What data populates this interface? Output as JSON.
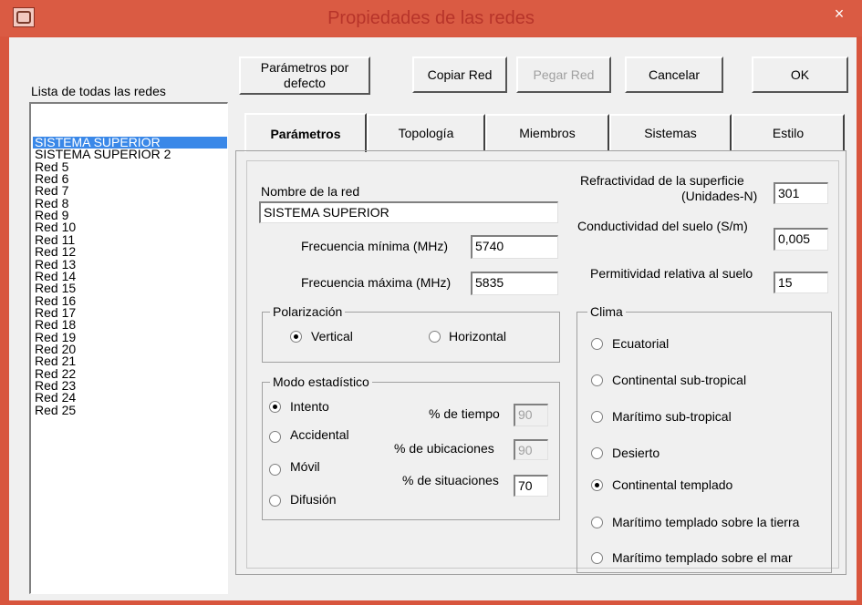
{
  "window": {
    "title": "Propiedades de las redes",
    "close_glyph": "×"
  },
  "toolbar": {
    "default_params": "Parámetros por defecto",
    "copy": "Copiar Red",
    "paste": "Pegar Red",
    "cancel": "Cancelar",
    "ok": "OK"
  },
  "list": {
    "label": "Lista de todas las redes",
    "items": [
      "SISTEMA SUPERIOR",
      "SISTEMA SUPERIOR 2",
      "Red 5",
      "Red 6",
      "Red 7",
      "Red 8",
      "Red 9",
      "Red 10",
      "Red 11",
      "Red 12",
      "Red 13",
      "Red 14",
      "Red 15",
      "Red 16",
      "Red 17",
      "Red 18",
      "Red 19",
      "Red 20",
      "Red 21",
      "Red 22",
      "Red 23",
      "Red 24",
      "Red 25"
    ],
    "selected": "SISTEMA SUPERIOR"
  },
  "tabs": [
    "Parámetros",
    "Topología",
    "Miembros",
    "Sistemas",
    "Estilo"
  ],
  "active_tab": "Parámetros",
  "params": {
    "name_label": "Nombre de la red",
    "name_value": "SISTEMA SUPERIOR",
    "fmin_label": "Frecuencia mínima (MHz)",
    "fmin_value": "5740",
    "fmax_label": "Frecuencia máxima (MHz)",
    "fmax_value": "5835",
    "refract_label_1": "Refractividad de la superficie",
    "refract_label_2": "(Unidades-N)",
    "refract_value": "301",
    "conduct_label": "Conductividad del suelo (S/m)",
    "conduct_value": "0,005",
    "permit_label": "Permitividad relativa al suelo",
    "permit_value": "15"
  },
  "polarization": {
    "label": "Polarización",
    "options": [
      "Vertical",
      "Horizontal"
    ],
    "selected": "Vertical"
  },
  "stat_mode": {
    "label": "Modo estadístico",
    "options": [
      "Intento",
      "Accidental",
      "Móvil",
      "Difusión"
    ],
    "selected": "Intento",
    "time_label": "% de tiempo",
    "time_value": "90",
    "loc_label": "% de ubicaciones",
    "loc_value": "90",
    "sit_label": "% de situaciones",
    "sit_value": "70"
  },
  "climate": {
    "label": "Clima",
    "options": [
      "Ecuatorial",
      "Continental sub-tropical",
      "Marítimo sub-tropical",
      "Desierto",
      "Continental templado",
      "Marítimo templado sobre la tierra",
      "Marítimo templado sobre el mar"
    ],
    "selected": "Continental templado"
  },
  "colors": {
    "titlebar": "#da5b43",
    "selection": "#3a88e8",
    "face": "#f0f0f0"
  }
}
